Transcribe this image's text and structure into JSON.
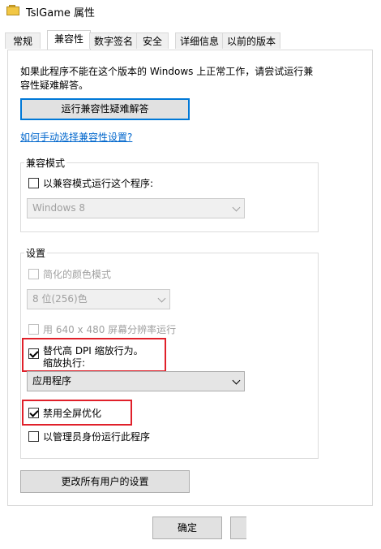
{
  "window": {
    "title": "TslGame 属性"
  },
  "tabs": [
    {
      "label": "常规"
    },
    {
      "label": "兼容性"
    },
    {
      "label": "数字签名"
    },
    {
      "label": "安全"
    },
    {
      "label": "详细信息"
    },
    {
      "label": "以前的版本"
    }
  ],
  "intro": {
    "line1": "如果此程序不能在这个版本的 Windows 上正常工作，请尝试运行兼",
    "line2": "容性疑难解答。"
  },
  "troubleshoot_button": "运行兼容性疑难解答",
  "manual_link": "如何手动选择兼容性设置?",
  "compat_mode": {
    "group_label": "兼容模式",
    "checkbox_label": "以兼容模式运行这个程序:",
    "os_select": "Windows 8"
  },
  "settings": {
    "group_label": "设置",
    "reduced_color_label": "简化的颜色模式",
    "color_select": "8 位(256)色",
    "res_640_label": "用 640 x 480 屏幕分辨率运行",
    "dpi_override_line1": "替代高 DPI 缩放行为。",
    "dpi_override_line2": "缩放执行:",
    "dpi_select": "应用程序",
    "disable_fullscreen_label": "禁用全屏优化",
    "run_as_admin_label": "以管理员身份运行此程序"
  },
  "change_all_users_button": "更改所有用户的设置",
  "footer": {
    "ok_button": "确定"
  },
  "colors": {
    "highlight": "#e0202a",
    "link": "#0066cc",
    "focus": "#0078d7"
  }
}
